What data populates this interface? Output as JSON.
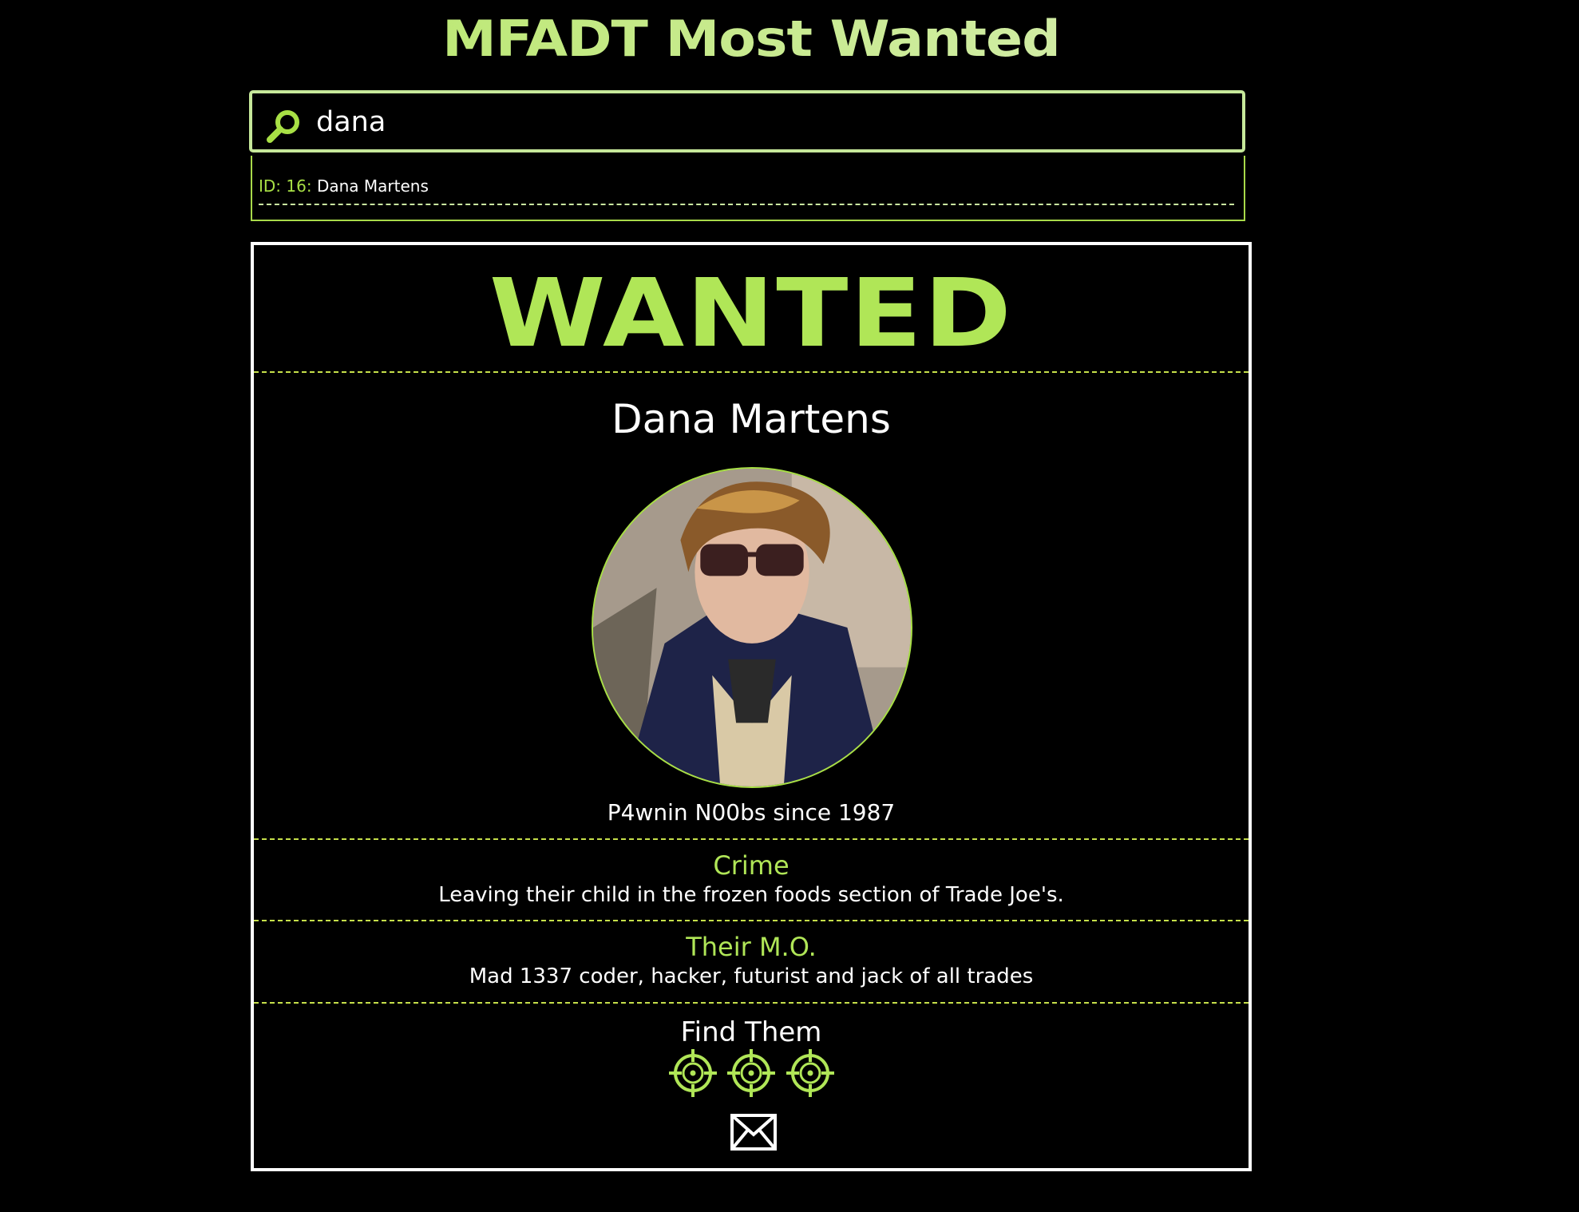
{
  "site": {
    "title": "MFADT Most Wanted"
  },
  "search": {
    "value": "dana",
    "placeholder": ""
  },
  "results": [
    {
      "id_label": "ID: 16:",
      "name": "Dana Martens"
    }
  ],
  "card": {
    "heading": "WANTED",
    "name": "Dana Martens",
    "tagline": "P4wnin N00bs since 1987",
    "crime": {
      "label": "Crime",
      "text": "Leaving their child in the frozen foods section of Trade Joe's."
    },
    "mo": {
      "label": "Their M.O.",
      "text": "Mad 1337 coder, hacker, futurist and jack of all trades"
    },
    "find": {
      "label": "Find Them",
      "links": [
        "target-icon",
        "target-icon",
        "target-icon"
      ],
      "contact_icon": "envelope-icon"
    }
  },
  "colors": {
    "accent": "#b0e657",
    "accent_light": "#c6e89a",
    "background": "#000000",
    "text": "#ffffff"
  }
}
